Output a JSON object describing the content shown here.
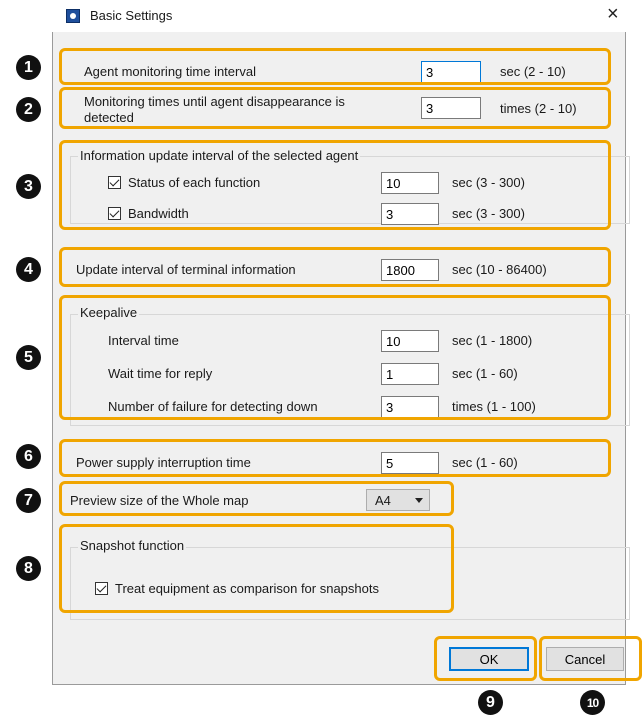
{
  "window": {
    "title": "Basic Settings",
    "close_glyph": "×"
  },
  "rows": {
    "agent_interval": {
      "label": "Agent monitoring time interval",
      "value": "3",
      "unit": "sec (2 - 10)"
    },
    "disappearance": {
      "label_line1": "Monitoring times until agent disappearance is",
      "label_line2": "detected",
      "value": "3",
      "unit": "times (2 - 10)"
    },
    "terminal": {
      "label": "Update interval of terminal information",
      "value": "1800",
      "unit": "sec (10 - 86400)"
    },
    "power": {
      "label": "Power supply interruption time",
      "value": "5",
      "unit": "sec (1 - 60)"
    }
  },
  "info_group": {
    "title": "Information update interval of the selected agent",
    "status": {
      "label": "Status of each function",
      "checked": true,
      "value": "10",
      "unit": "sec (3 - 300)"
    },
    "bandwidth": {
      "label": "Bandwidth",
      "checked": true,
      "value": "3",
      "unit": "sec (3 - 300)"
    }
  },
  "keepalive": {
    "title": "Keepalive",
    "interval": {
      "label": "Interval time",
      "value": "10",
      "unit": "sec (1 - 1800)"
    },
    "wait": {
      "label": "Wait time for reply",
      "value": "1",
      "unit": "sec (1 - 60)"
    },
    "failure": {
      "label": "Number of failure for detecting down",
      "value": "3",
      "unit": "times (1 - 100)"
    }
  },
  "preview": {
    "label": "Preview size of the Whole map",
    "selected": "A4"
  },
  "snapshot": {
    "title": "Snapshot function",
    "treat": {
      "label": "Treat equipment as comparison for snapshots",
      "checked": true
    }
  },
  "buttons": {
    "ok": "OK",
    "cancel": "Cancel"
  },
  "callouts": [
    "1",
    "2",
    "3",
    "4",
    "5",
    "6",
    "7",
    "8",
    "9",
    "10"
  ],
  "colors": {
    "callout_border": "#f0a500",
    "badge_fill": "#111111",
    "focus_border": "#0078d7"
  },
  "icons": {
    "app": "app-icon",
    "close": "close-icon",
    "dropdown": "chevron-down-icon",
    "check": "checkmark-icon"
  }
}
